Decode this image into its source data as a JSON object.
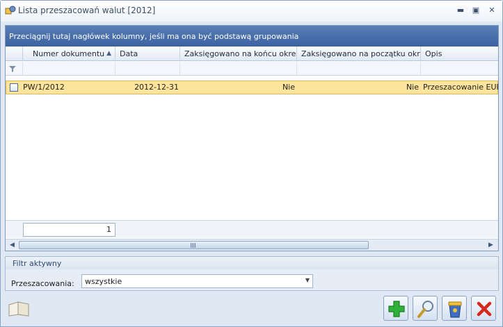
{
  "window": {
    "title": "Lista przeszacowań walut [2012]",
    "minimize_glyph": "▬",
    "maximize_glyph": "▣",
    "close_glyph": "✕"
  },
  "grid": {
    "group_hint": "Przeciągnij tutaj nagłówek kolumny, jeśli ma ona być podstawą grupowania",
    "columns": [
      {
        "label": "Numer dokumentu",
        "sorted": "ascending"
      },
      {
        "label": "Data"
      },
      {
        "label": "Zaksięgowano na końcu okresu"
      },
      {
        "label": "Zaksięgowano na początku okresu"
      },
      {
        "label": "Opis"
      }
    ],
    "sort_glyph": "▲",
    "rows": [
      {
        "numer": "PW/1/2012",
        "data": "2012-12-31",
        "koniec": "Nie",
        "poczatek": "Nie",
        "opis": "Przeszacowanie EUR"
      }
    ],
    "row_count": "1"
  },
  "scrollbar": {
    "left_glyph": "◀",
    "right_glyph": "▶"
  },
  "filter": {
    "caption": "Filtr aktywny",
    "label": "Przeszacowania:",
    "value": "wszystkie",
    "dropdown_glyph": "▼"
  },
  "icons": {
    "book": "book-icon",
    "add": "plus-icon",
    "edit": "magnifier-icon",
    "delete": "trash-icon",
    "close": "close-icon"
  },
  "colors": {
    "group_bar": "#4a70ad",
    "selected_row": "#fde49d",
    "add_green": "#2fb23a",
    "close_red": "#d6271d"
  }
}
